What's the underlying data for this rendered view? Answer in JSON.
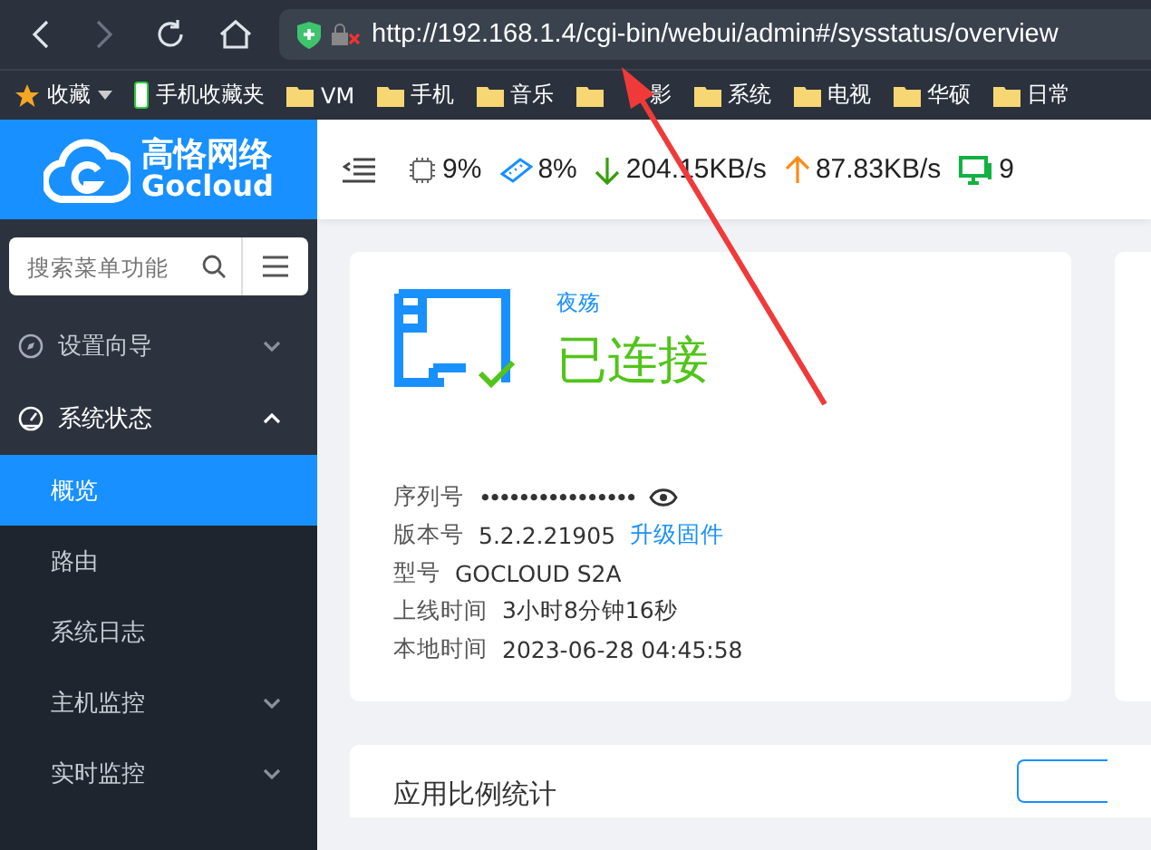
{
  "browser": {
    "url": "http://192.168.1.4/cgi-bin/webui/admin#/sysstatus/overview",
    "bookmarks": [
      {
        "label": "收藏",
        "kind": "star"
      },
      {
        "label": "手机收藏夹",
        "kind": "phone"
      },
      {
        "label": "VM",
        "kind": "folder"
      },
      {
        "label": "手机",
        "kind": "folder"
      },
      {
        "label": "音乐",
        "kind": "folder"
      },
      {
        "label": "影",
        "kind": "folder",
        "covered": true
      },
      {
        "label": "系统",
        "kind": "folder"
      },
      {
        "label": "电视",
        "kind": "folder"
      },
      {
        "label": "华硕",
        "kind": "folder"
      },
      {
        "label": "日常",
        "kind": "folder"
      }
    ]
  },
  "logo": {
    "name": "高恪网络",
    "brand": "Gocloud"
  },
  "stats": [
    {
      "kind": "cpu",
      "value": "9%"
    },
    {
      "kind": "memory",
      "value": "8%"
    },
    {
      "kind": "download",
      "value": "204.15KB/s"
    },
    {
      "kind": "upload",
      "value": "87.83KB/s"
    },
    {
      "kind": "hosts",
      "value": "9"
    }
  ],
  "sidebar": {
    "search": {
      "placeholder": "搜索菜单功能"
    },
    "items": [
      {
        "label": "设置向导",
        "expanded": false,
        "selected": false
      },
      {
        "label": "系统状态",
        "expanded": true,
        "selected": false,
        "children": [
          {
            "label": "概览",
            "selected": true
          },
          {
            "label": "路由",
            "selected": false
          },
          {
            "label": "系统日志",
            "selected": false
          },
          {
            "label": "主机监控",
            "selected": false,
            "expandable": true
          },
          {
            "label": "实时监控",
            "selected": false,
            "expandable": true
          }
        ]
      }
    ]
  },
  "status_card": {
    "name": "夜殇",
    "status": "已连接",
    "fields": [
      {
        "label": "序列号",
        "value": "••••••••••••••••",
        "kind": "secret"
      },
      {
        "label": "版本号",
        "value": "5.2.2.21905",
        "link": "升级固件"
      },
      {
        "label": "型号",
        "value": "GOCLOUD S2A"
      },
      {
        "label": "上线时间",
        "value": "3小时8分钟16秒"
      },
      {
        "label": "本地时间",
        "value": "2023-06-28 04:45:58"
      }
    ]
  },
  "bottom_card": {
    "title": "应用比例统计"
  }
}
